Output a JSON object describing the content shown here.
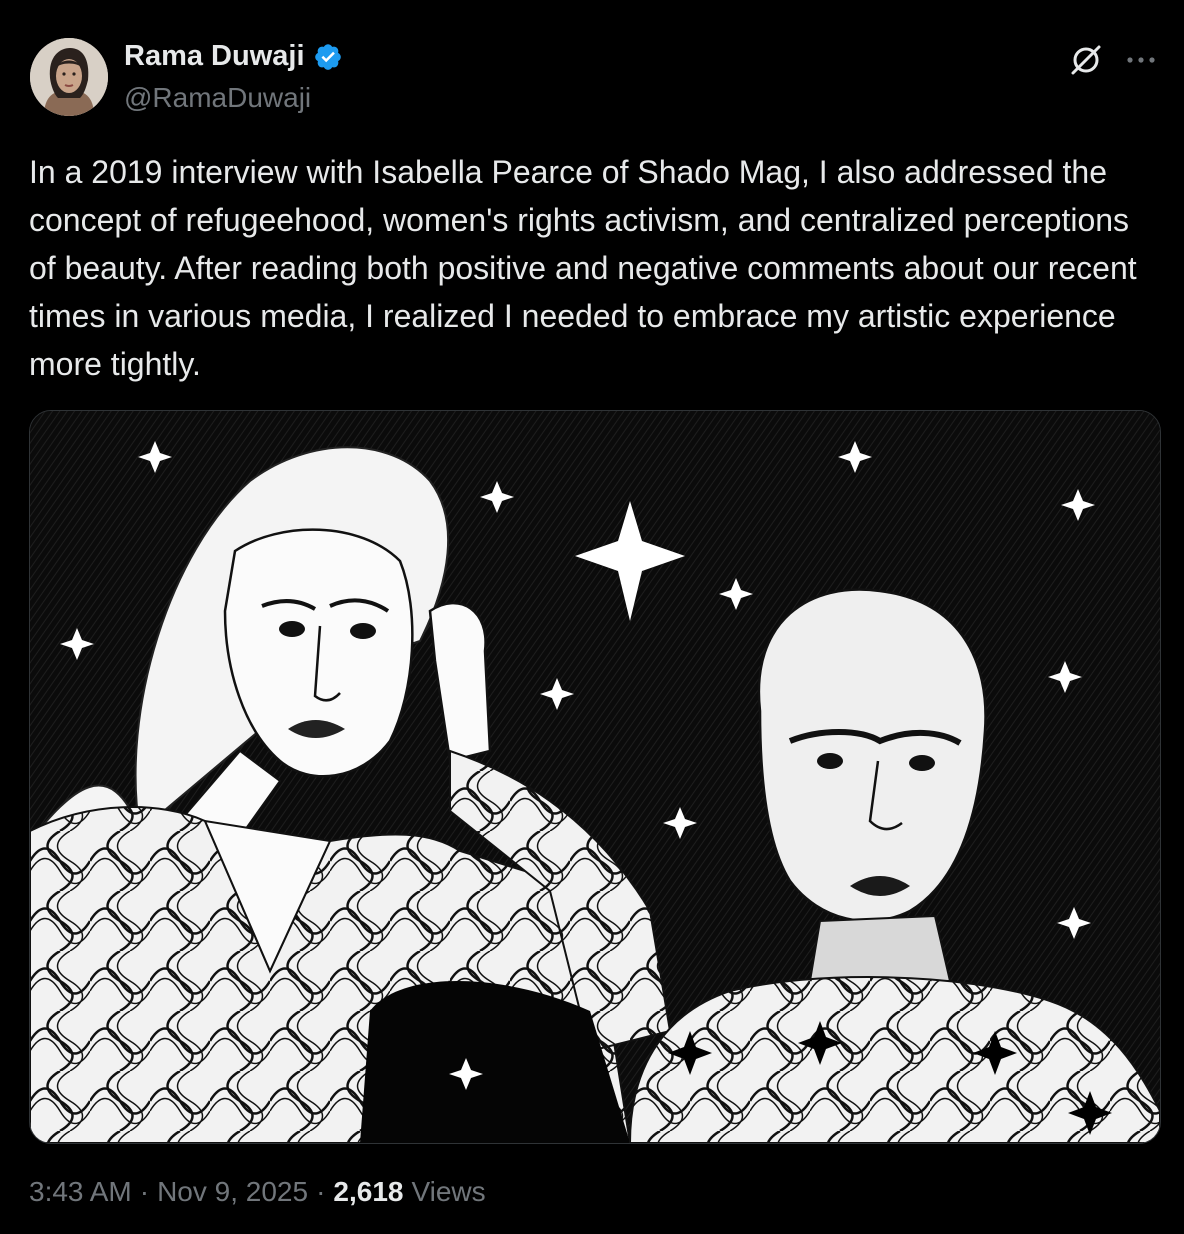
{
  "tweet": {
    "author": {
      "name": "Rama Duwaji",
      "handle": "@RamaDuwaji",
      "verified": true
    },
    "text": "In a 2019 interview with Isabella Pearce of Shado Mag, I also addressed the concept of refugeehood, women's rights activism, and centralized perceptions of beauty. After reading both positive and negative comments about our recent times in various media, I realized I needed to embrace my artistic experience more tightly.",
    "media": {
      "type": "illustration"
    },
    "timestamp": {
      "time": "3:43 AM",
      "date": "Nov 9, 2025"
    },
    "views": {
      "count": "2,618",
      "label": "Views"
    },
    "separator": "·"
  },
  "colors": {
    "background": "#000000",
    "text_primary": "#e7e9ea",
    "text_secondary": "#71767b",
    "verified_blue": "#1d9bf0",
    "border": "#2f3336"
  },
  "icons": {
    "verified": "verified-badge-icon",
    "grok": "grok-icon",
    "more": "more-horizontal-icon"
  }
}
